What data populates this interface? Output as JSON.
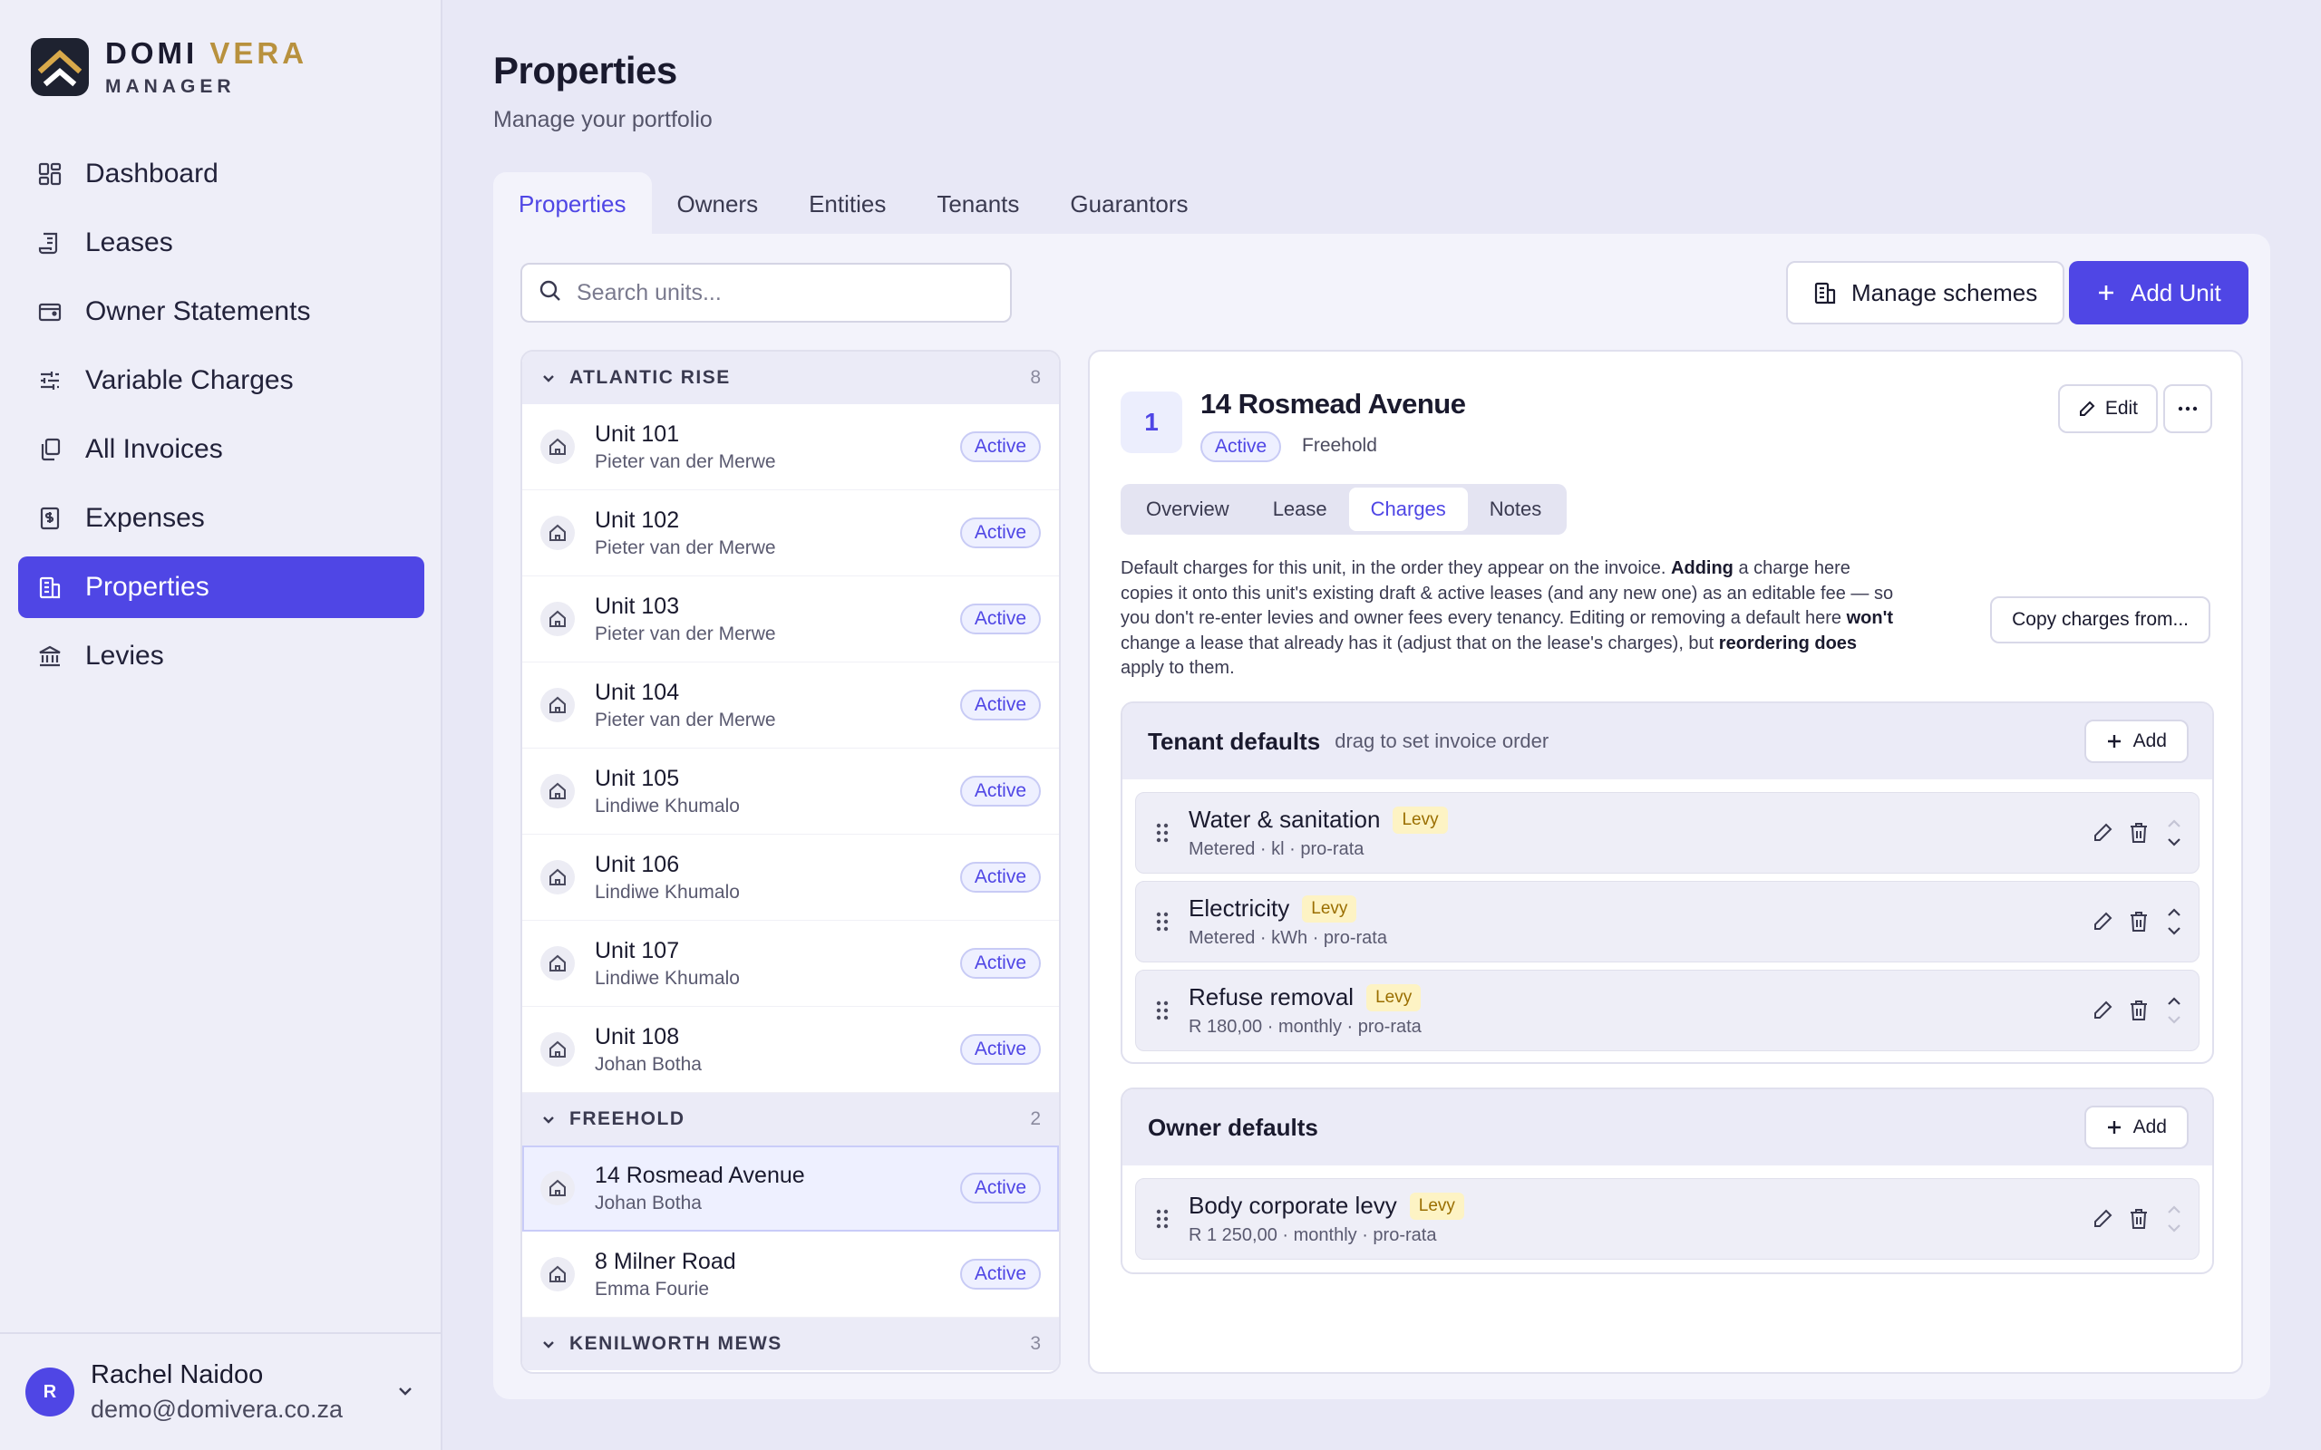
{
  "brand": {
    "word1": "DOMI",
    "word2": "VERA",
    "sub": "MANAGER"
  },
  "nav": [
    {
      "label": "Dashboard",
      "icon": "dashboard-icon"
    },
    {
      "label": "Leases",
      "icon": "leases-icon"
    },
    {
      "label": "Owner Statements",
      "icon": "wallet-icon"
    },
    {
      "label": "Variable Charges",
      "icon": "sliders-icon"
    },
    {
      "label": "All Invoices",
      "icon": "invoices-icon"
    },
    {
      "label": "Expenses",
      "icon": "receipt-icon"
    },
    {
      "label": "Properties",
      "icon": "building-icon",
      "active": true
    },
    {
      "label": "Levies",
      "icon": "bank-icon"
    }
  ],
  "user": {
    "initial": "R",
    "name": "Rachel Naidoo",
    "email": "demo@domivera.co.za"
  },
  "page": {
    "title": "Properties",
    "subtitle": "Manage your portfolio"
  },
  "tabs": [
    "Properties",
    "Owners",
    "Entities",
    "Tenants",
    "Guarantors"
  ],
  "toolbar": {
    "search_placeholder": "Search units...",
    "manage_label": "Manage schemes",
    "add_unit_label": "Add Unit"
  },
  "groups": [
    {
      "name": "ATLANTIC RISE",
      "count": "8",
      "units": [
        {
          "name": "Unit 101",
          "owner": "Pieter van der Merwe",
          "status": "Active"
        },
        {
          "name": "Unit 102",
          "owner": "Pieter van der Merwe",
          "status": "Active"
        },
        {
          "name": "Unit 103",
          "owner": "Pieter van der Merwe",
          "status": "Active"
        },
        {
          "name": "Unit 104",
          "owner": "Pieter van der Merwe",
          "status": "Active"
        },
        {
          "name": "Unit 105",
          "owner": "Lindiwe Khumalo",
          "status": "Active"
        },
        {
          "name": "Unit 106",
          "owner": "Lindiwe Khumalo",
          "status": "Active"
        },
        {
          "name": "Unit 107",
          "owner": "Lindiwe Khumalo",
          "status": "Active"
        },
        {
          "name": "Unit 108",
          "owner": "Johan Botha",
          "status": "Active"
        }
      ]
    },
    {
      "name": "FREEHOLD",
      "count": "2",
      "units": [
        {
          "name": "14 Rosmead Avenue",
          "owner": "Johan Botha",
          "status": "Active",
          "selected": true
        },
        {
          "name": "8 Milner Road",
          "owner": "Emma Fourie",
          "status": "Active"
        }
      ]
    },
    {
      "name": "KENILWORTH MEWS",
      "count": "3",
      "units": []
    }
  ],
  "detail": {
    "number": "1",
    "title": "14 Rosmead Avenue",
    "status": "Active",
    "type": "Freehold",
    "edit_label": "Edit",
    "sub_tabs": [
      "Overview",
      "Lease",
      "Charges",
      "Notes"
    ],
    "desc": {
      "p1": "Default charges for this unit, in the order they appear on the invoice. ",
      "b1": "Adding",
      "p2": " a charge here copies it onto this unit's existing draft & active leases (and any new one) as an editable fee — so you don't re-enter levies and owner fees every tenancy. Editing or removing a default here ",
      "b2": "won't",
      "p3": " change a lease that already has it (adjust that on the lease's charges), but ",
      "b3": "reordering does",
      "p4": " apply to them."
    },
    "copy_label": "Copy charges from...",
    "tenant": {
      "title": "Tenant defaults",
      "hint": "drag to set invoice order",
      "add_label": "Add",
      "charges": [
        {
          "name": "Water & sanitation",
          "tag": "Levy",
          "meta": "Metered · kl · pro-rata"
        },
        {
          "name": "Electricity",
          "tag": "Levy",
          "meta": "Metered · kWh · pro-rata"
        },
        {
          "name": "Refuse removal",
          "tag": "Levy",
          "meta": "R 180,00 · monthly · pro-rata"
        }
      ]
    },
    "owner": {
      "title": "Owner defaults",
      "add_label": "Add",
      "charges": [
        {
          "name": "Body corporate levy",
          "tag": "Levy",
          "meta": "R 1 250,00 · monthly · pro-rata"
        }
      ]
    }
  },
  "colors": {
    "accent": "#4f46e5",
    "gold": "#b8913e",
    "levy_bg": "#fdf3c4",
    "levy_fg": "#9a6e00"
  }
}
